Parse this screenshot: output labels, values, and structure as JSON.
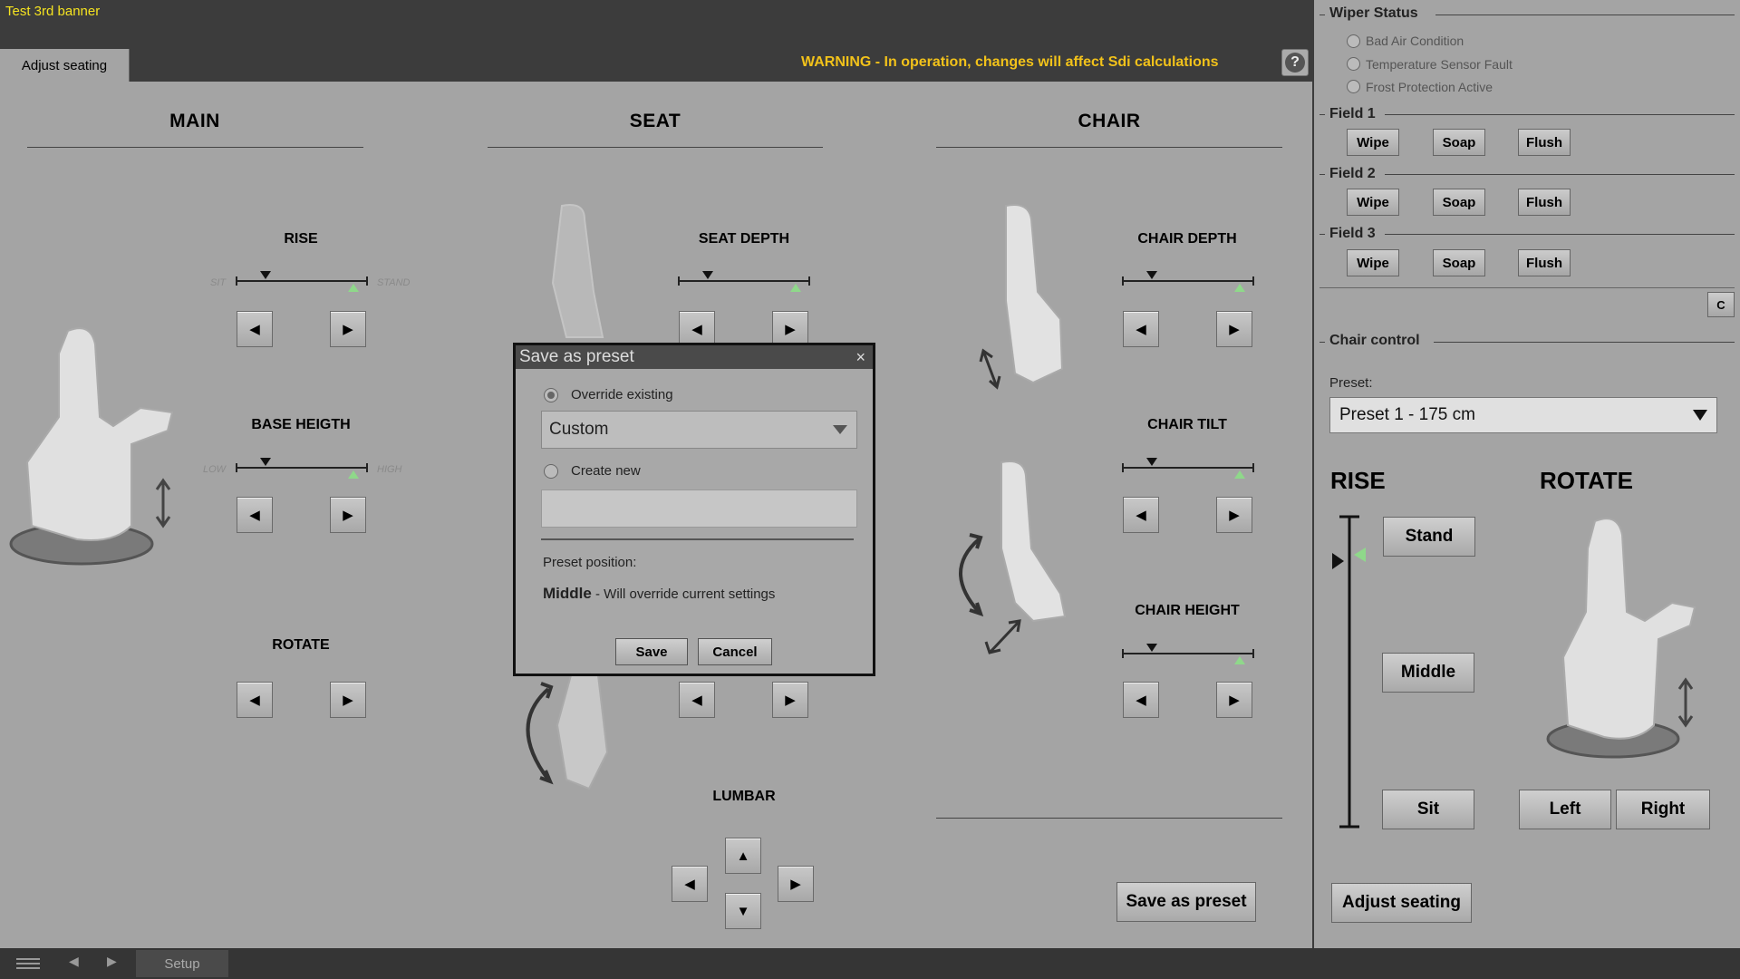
{
  "banner": "Test 3rd banner",
  "tab": "Adjust seating",
  "warning": "WARNING - In operation, changes will affect Sdi calculations",
  "help": "?",
  "columns": {
    "main": "MAIN",
    "seat": "SEAT",
    "chair": "CHAIR"
  },
  "main": {
    "rise": {
      "title": "RISE",
      "left_label": "SIT",
      "right_label": "STAND"
    },
    "base": {
      "title": "BASE HEIGTH",
      "left_label": "LOW",
      "right_label": "HIGH"
    },
    "rotate": {
      "title": "ROTATE"
    }
  },
  "seat": {
    "depth": {
      "title": "SEAT DEPTH"
    },
    "lumbar": {
      "title": "LUMBAR"
    }
  },
  "chair": {
    "depth": {
      "title": "CHAIR DEPTH"
    },
    "tilt": {
      "title": "CHAIR TILT"
    },
    "height": {
      "title": "CHAIR HEIGHT"
    }
  },
  "arrows": {
    "left": "◀",
    "right": "▶",
    "up": "▲",
    "down": "▼"
  },
  "save_preset_button": "Save as preset",
  "dialog": {
    "title": "Save as preset",
    "close": "×",
    "override_label": "Override existing",
    "override_value": "Custom",
    "create_label": "Create new",
    "create_value": "",
    "position_label": "Preset position:",
    "position_value": "Middle",
    "position_note": " - Will override current settings",
    "save": "Save",
    "cancel": "Cancel"
  },
  "right": {
    "wiper_title": "Wiper Status",
    "wiper_items": [
      "Bad Air Condition",
      "Temperature Sensor Fault",
      "Frost Protection Active"
    ],
    "fields": [
      {
        "title": "Field 1",
        "buttons": [
          "Wipe",
          "Soap",
          "Flush"
        ]
      },
      {
        "title": "Field 2",
        "buttons": [
          "Wipe",
          "Soap",
          "Flush"
        ]
      },
      {
        "title": "Field 3",
        "buttons": [
          "Wipe",
          "Soap",
          "Flush"
        ]
      }
    ],
    "c_button": "C",
    "chair_control": "Chair control",
    "preset_label": "Preset:",
    "preset_value": "Preset 1 - 175 cm",
    "rise_title": "RISE",
    "rotate_title": "ROTATE",
    "stand": "Stand",
    "middle": "Middle",
    "sit": "Sit",
    "left": "Left",
    "right": "Right",
    "adjust_seating": "Adjust seating"
  },
  "bottom": {
    "setup": "Setup",
    "nav_left": "◀",
    "nav_right": "▶"
  }
}
